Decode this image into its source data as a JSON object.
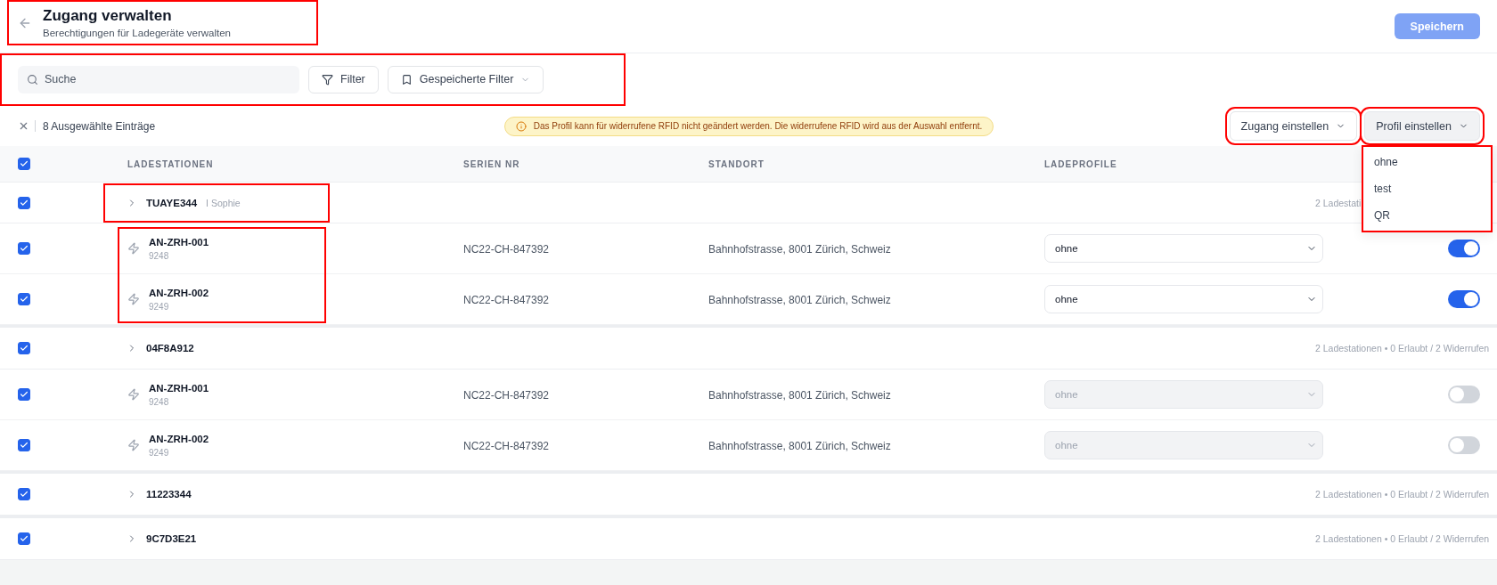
{
  "header": {
    "title": "Zugang verwalten",
    "subtitle": "Berechtigungen für Ladegeräte verwalten",
    "highlighted": true,
    "save_button": "Speichern"
  },
  "filter_bar": {
    "highlighted": true,
    "search": {
      "placeholder": "Suche"
    },
    "filter_button": "Filter",
    "saved_filters_button": "Gespeicherte Filter"
  },
  "selection_bar": {
    "count_label": "8 Ausgewählte Einträge",
    "notice": "Das Profil kann für widerrufene RFID nicht geändert werden. Die widerrufene RFID wird aus der Auswahl entfernt.",
    "actions": [
      {
        "label": "Zugang einstellen",
        "highlighted": true,
        "open": false
      },
      {
        "label": "Profil einstellen",
        "highlighted": true,
        "open": true
      }
    ],
    "menu": {
      "highlighted": true,
      "items": [
        "ohne",
        "test",
        "QR"
      ]
    }
  },
  "table": {
    "all_checked": true,
    "columns": [
      "LADESTATIONEN",
      "SERIEN NR",
      "STANDORT",
      "LADEPROFILE"
    ],
    "groups": [
      {
        "name": "TUAYE344",
        "owner": "I Sophie",
        "summary": "2 Ladestati",
        "checked": true,
        "highlighted": true,
        "stations_highlighted": true,
        "stations": [
          {
            "name": "AN-ZRH-001",
            "id": "9248",
            "serial": "NC22-CH-847392",
            "location": "Bahnhofstrasse, 8001 Zürich, Schweiz",
            "profile": "ohne",
            "disabled": false,
            "on": true,
            "checked": true
          },
          {
            "name": "AN-ZRH-002",
            "id": "9249",
            "serial": "NC22-CH-847392",
            "location": "Bahnhofstrasse, 8001 Zürich, Schweiz",
            "profile": "ohne",
            "disabled": false,
            "on": true,
            "checked": true
          }
        ]
      },
      {
        "name": "04F8A912",
        "summary": "2 Ladestationen • 0 Erlaubt / 2 Widerrufen",
        "checked": true,
        "highlighted": false,
        "stations": [
          {
            "name": "AN-ZRH-001",
            "id": "9248",
            "serial": "NC22-CH-847392",
            "location": "Bahnhofstrasse, 8001 Zürich, Schweiz",
            "profile": "ohne",
            "disabled": true,
            "on": false,
            "checked": true
          },
          {
            "name": "AN-ZRH-002",
            "id": "9249",
            "serial": "NC22-CH-847392",
            "location": "Bahnhofstrasse, 8001 Zürich, Schweiz",
            "profile": "ohne",
            "disabled": true,
            "on": false,
            "checked": true
          }
        ]
      },
      {
        "name": "11223344",
        "summary": "2 Ladestationen • 0 Erlaubt / 2 Widerrufen",
        "checked": true,
        "highlighted": false
      },
      {
        "name": "9C7D3E21",
        "summary": "2 Ladestationen • 0 Erlaubt / 2 Widerrufen",
        "checked": true,
        "highlighted": false
      }
    ]
  }
}
